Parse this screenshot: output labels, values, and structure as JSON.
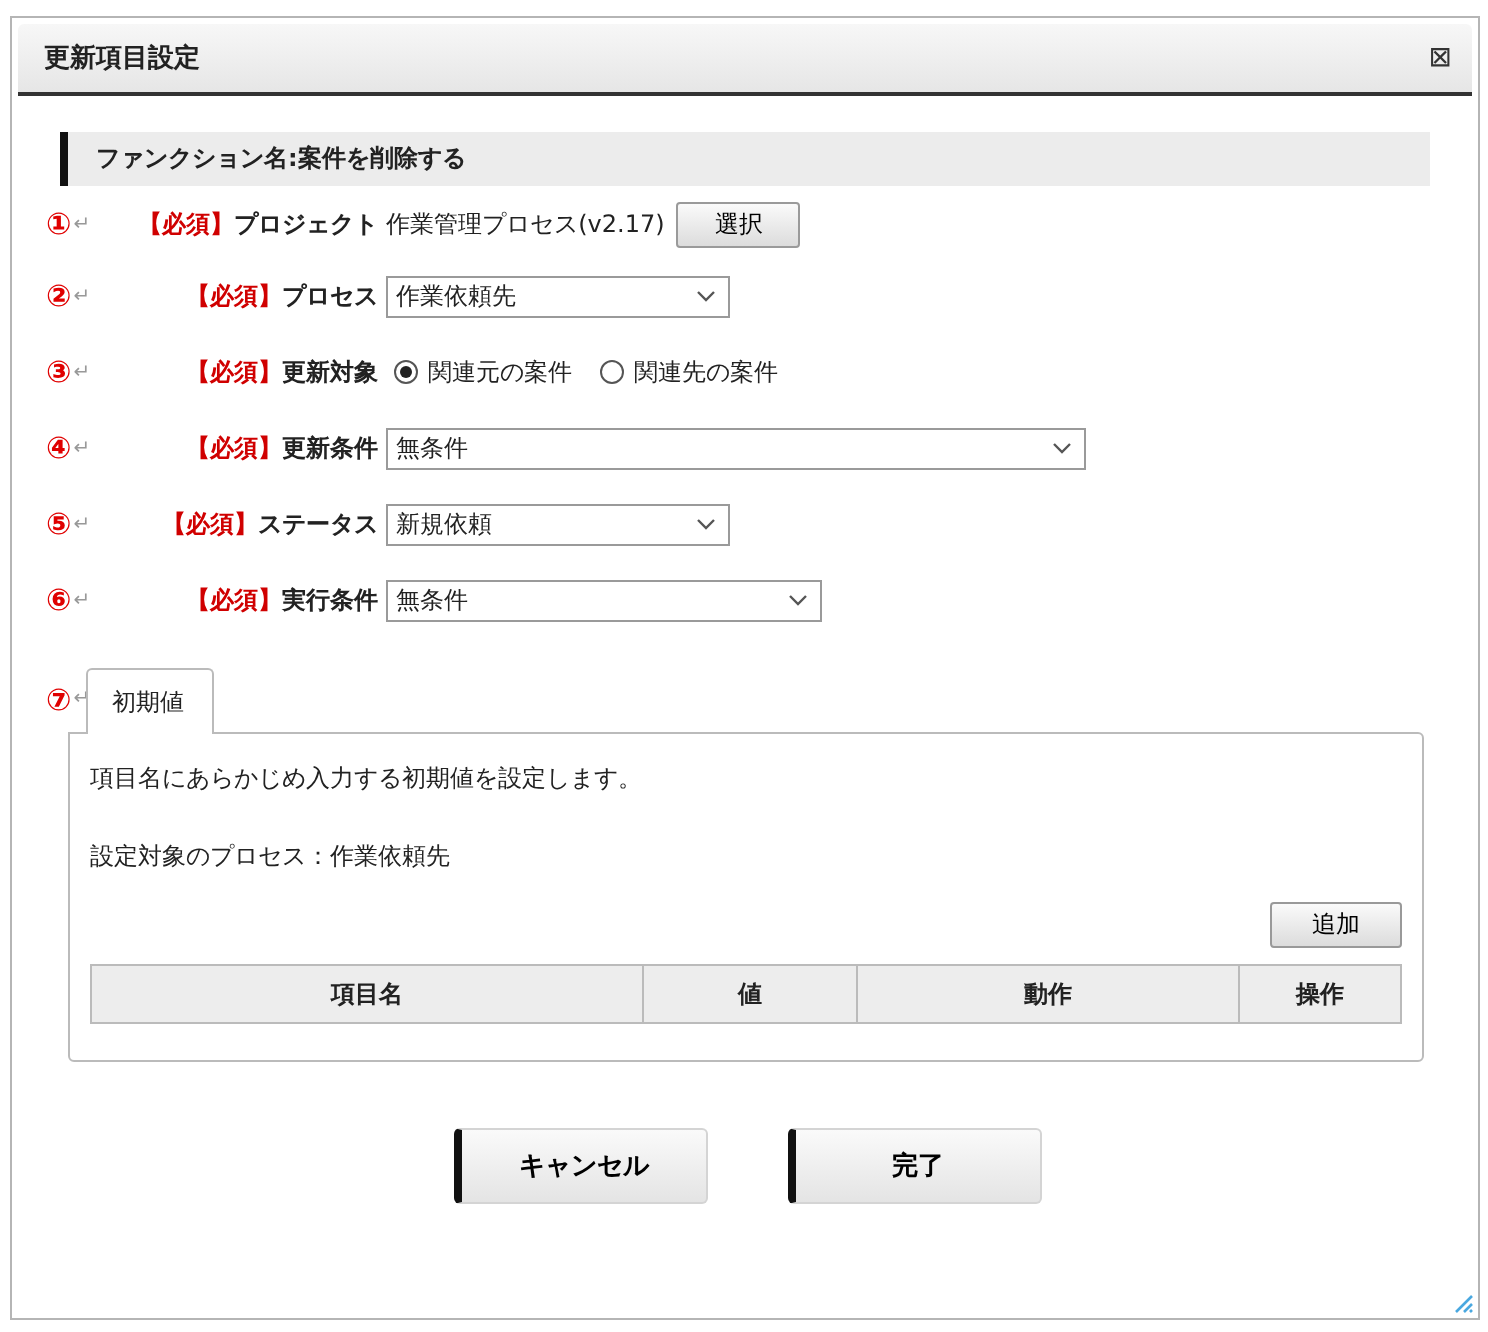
{
  "window": {
    "title": "更新項目設定",
    "close": "⊠"
  },
  "section_title": "ファンクション名:案件を削除する",
  "fields": [
    {
      "number": "①",
      "return_mark": "↵",
      "required": "【必須】",
      "label": "プロジェクト",
      "kind": "text_button",
      "value": "作業管理プロセス(v2.17)",
      "button": "選択"
    },
    {
      "number": "②",
      "return_mark": "↵",
      "required": "【必須】",
      "label": "プロセス",
      "kind": "select",
      "value": "作業依頼先"
    },
    {
      "number": "③",
      "return_mark": "↵",
      "required": "【必須】",
      "label": "更新対象",
      "kind": "radio",
      "options": [
        {
          "label": "関連元の案件",
          "selected": true
        },
        {
          "label": "関連先の案件",
          "selected": false
        }
      ]
    },
    {
      "number": "④",
      "return_mark": "↵",
      "required": "【必須】",
      "label": "更新条件",
      "kind": "select",
      "value": "無条件"
    },
    {
      "number": "⑤",
      "return_mark": "↵",
      "required": "【必須】",
      "label": "ステータス",
      "kind": "select",
      "value": "新規依頼"
    },
    {
      "number": "⑥",
      "return_mark": "↵",
      "required": "【必須】",
      "label": "実行条件",
      "kind": "select",
      "value": "無条件"
    }
  ],
  "tab_marker": {
    "number": "⑦",
    "return_mark": "↵"
  },
  "tabs": [
    {
      "label": "初期値",
      "selected": true
    }
  ],
  "panel": {
    "description": "項目名にあらかじめ入力する初期値を設定します。",
    "process_line": "設定対象のプロセス：作業依頼先",
    "add_button": "追加",
    "table": {
      "columns": [
        "項目名",
        "値",
        "動作",
        "操作"
      ]
    }
  },
  "buttons": [
    "キャンセル",
    "完了"
  ]
}
